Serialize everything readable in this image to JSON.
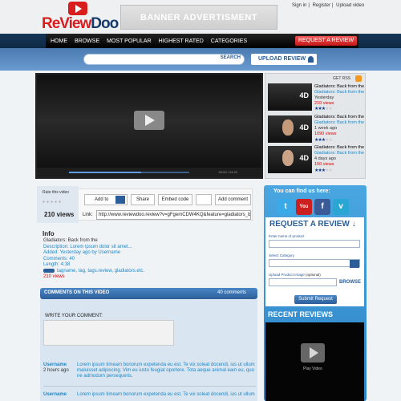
{
  "header": {
    "logo_text_red": "ReView",
    "logo_text_dark": "Doo",
    "banner": "BANNER ADVERTISMENT",
    "links": [
      "Sign in",
      "Register",
      "Upload video"
    ]
  },
  "nav": {
    "items": [
      "HOME",
      "BROWSE",
      "MOST POPULAR",
      "HIGHEST RATED",
      "CATEGORIES"
    ],
    "request_button": "REQUEST A REVIEW"
  },
  "search": {
    "button": "SEARCH",
    "upload": "UPLOAD REVIEW"
  },
  "player": {
    "time": "00:00 / 04:34"
  },
  "sidebar": {
    "header": "GET RSS",
    "videos": [
      {
        "title": "Gladiators: Back from the",
        "subtitle": "Gladiators: Back from the",
        "ago": "Yesterday",
        "views": "210 views",
        "rating": 3,
        "badge": "4D"
      },
      {
        "title": "Gladiators: Back from the",
        "subtitle": "Gladiators: Back from the",
        "ago": "1 week ago",
        "views": "1090 views",
        "rating": 3,
        "badge": "4D"
      },
      {
        "title": "Gladiators: Back from the",
        "subtitle": "Gladiators: Back from the",
        "ago": "4 days ago",
        "views": "150 views",
        "rating": 3,
        "badge": "4D"
      }
    ]
  },
  "rate": {
    "label": "Rate this video",
    "views": "210 views",
    "add_to": "Add to",
    "share": "Share",
    "embed": "Embed code",
    "add_comment": "Add comment",
    "link_label": "Link:",
    "link": "http://www.reviewdoo.review?v=gFgemCDW4KQ&feature=gladiators_ba"
  },
  "info": {
    "heading": "Info",
    "title": "Gladiators: Back from the",
    "description": "Description: Lorem ipsum dolor sit amet...",
    "added": "Added: Yesterday ago by Username",
    "comments": "Comments: 40",
    "length": "Length: 4:38",
    "tags": "tagname, tag, tags.review, gladiators.etc.",
    "views": "210 views"
  },
  "comments": {
    "heading": "COMMENTS ON THIS VIDEO",
    "count": "40 comments",
    "write_label": "WRITE YOUR COMMENT:",
    "items": [
      {
        "user": "Username",
        "time": "2 hours ago",
        "text": "Lorem ipsum timeam bonorum expetenda eu est. Te vix soleat docendi, ius ut ullum maluisset adipiscing. Vim eu iusto feugiat oportere. Tota aeque animal eam eu, quo ne admodum persequeris."
      },
      {
        "user": "Username",
        "time": "",
        "text": "Lorem ipsum timeam bonorum expetenda eu est. Te vix soleat docendi, ius ut ullum"
      }
    ]
  },
  "right": {
    "find_us": "You can find us here:",
    "social": [
      {
        "name": "twitter",
        "glyph": "t",
        "color": "#3aa9e8"
      },
      {
        "name": "youtube",
        "glyph": "You",
        "color": "#cc2020"
      },
      {
        "name": "facebook",
        "glyph": "f",
        "color": "#3b5b98"
      },
      {
        "name": "vimeo",
        "glyph": "v",
        "color": "#29a6d4"
      }
    ],
    "request_title": "REQUEST A REVIEW",
    "product_label": "Enter name of product",
    "category_label": "Select Category",
    "upload_label": "Upload Product Image",
    "upload_note": "(optional)",
    "browse": "BROWSE",
    "submit": "Submit Request",
    "recent": "RECENT REVIEWS",
    "play_video": "Play Video"
  },
  "colors": {
    "accent": "#2b5d98",
    "brand_red": "#d91c1c",
    "link": "#1e86c7"
  }
}
